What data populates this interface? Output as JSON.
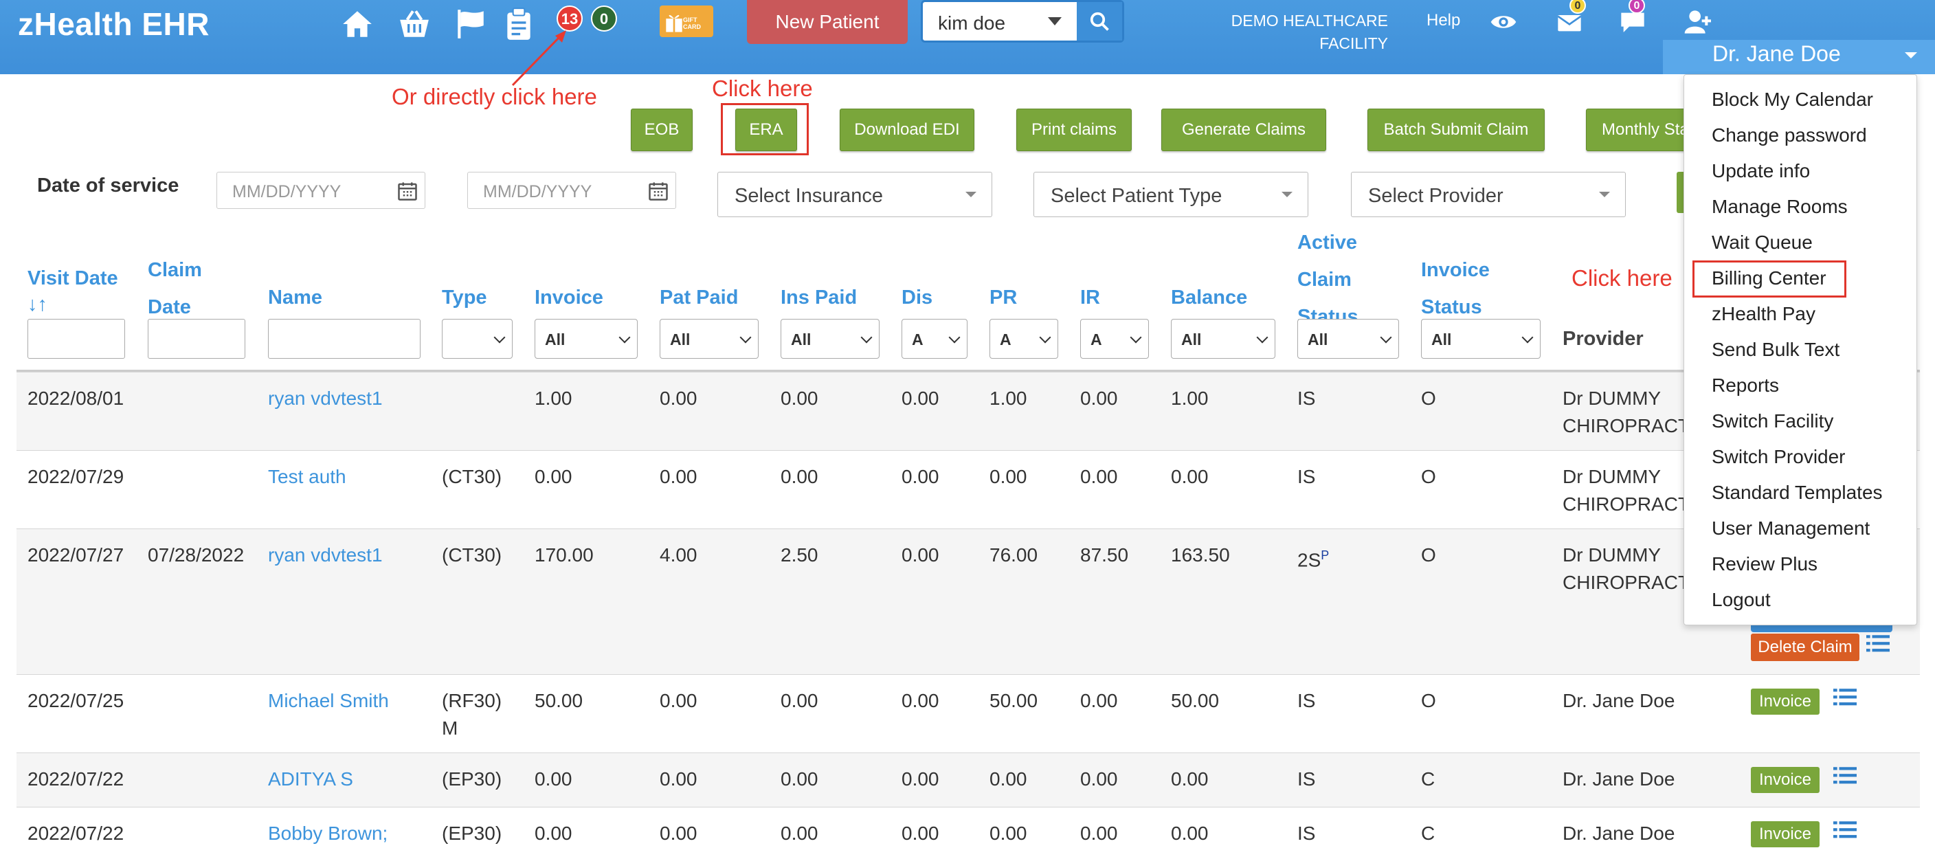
{
  "header": {
    "brand": "zHealth EHR",
    "badge_red": "13",
    "badge_green": "0",
    "gift_label": "GIFT CARD",
    "new_patient": "New Patient",
    "search_value": "kim doe",
    "facility_line1": "DEMO HEALTHCARE",
    "facility_line2": "FACILITY",
    "help": "Help",
    "mail_badge": "0",
    "chat_badge": "0",
    "user": "Dr. Jane Doe",
    "icons": [
      "home-icon",
      "basket-icon",
      "flag-icon",
      "clipboard-icon",
      "eye-icon",
      "mail-icon",
      "chat-icon",
      "add-user-icon",
      "search-icon"
    ]
  },
  "annotations": {
    "direct": "Or directly click here",
    "click_era": "Click here",
    "click_billing": "Click here"
  },
  "buttons": {
    "eob": "EOB",
    "era": "ERA",
    "download_edi": "Download EDI",
    "print_claims": "Print claims",
    "generate_claims": "Generate Claims",
    "batch_submit": "Batch Submit Claim",
    "monthly": "Monthly Sta"
  },
  "filters": {
    "dos_label": "Date of service",
    "from_placeholder": "MM/DD/YYYY",
    "to_placeholder": "MM/DD/YYYY",
    "insurance": "Select Insurance",
    "patient_type": "Select Patient Type",
    "provider": "Select Provider"
  },
  "columns": {
    "visit_date_1": "Visit Date",
    "visit_date_2": "↓↑",
    "claim_date_1": "Claim",
    "claim_date_2": "Date",
    "name": "Name",
    "type": "Type",
    "invoice": "Invoice",
    "pat_paid": "Pat Paid",
    "ins_paid": "Ins Paid",
    "dis": "Dis",
    "pr": "PR",
    "ir": "IR",
    "balance": "Balance",
    "active_1": "Active",
    "active_2": "Claim",
    "active_3": "Status",
    "invoice_status_1": "Invoice",
    "invoice_status_2": "Status",
    "provider": "Provider"
  },
  "column_filters": {
    "all": "All",
    "short": "A"
  },
  "rows": [
    {
      "visit": "2022/08/01",
      "claim": "",
      "name": "ryan vdvtest1",
      "type": "",
      "type2": "",
      "invoice": "1.00",
      "pat": "0.00",
      "ins": "0.00",
      "dis": "0.00",
      "pr": "1.00",
      "ir": "0.00",
      "bal": "1.00",
      "status": "IS",
      "status_sup": "",
      "inv_status": "O",
      "prov1": "Dr DUMMY",
      "prov2": "CHIROPRACT"
    },
    {
      "visit": "2022/07/29",
      "claim": "",
      "name": "Test auth",
      "type": "(CT30)",
      "type2": "",
      "invoice": "0.00",
      "pat": "0.00",
      "ins": "0.00",
      "dis": "0.00",
      "pr": "0.00",
      "ir": "0.00",
      "bal": "0.00",
      "status": "IS",
      "status_sup": "",
      "inv_status": "O",
      "prov1": "Dr DUMMY",
      "prov2": "CHIROPRACT"
    },
    {
      "visit": "2022/07/27",
      "claim": "07/28/2022",
      "name": "ryan vdvtest1",
      "type": "(CT30)",
      "type2": "",
      "invoice": "170.00",
      "pat": "4.00",
      "ins": "2.50",
      "dis": "0.00",
      "pr": "76.00",
      "ir": "87.50",
      "bal": "163.50",
      "status": "2S",
      "status_sup": "P",
      "inv_status": "O",
      "prov1": "Dr DUMMY",
      "prov2": "CHIROPRACT",
      "action": "Delete Claim"
    },
    {
      "visit": "2022/07/25",
      "claim": "",
      "name": "Michael Smith",
      "type": "(RF30)",
      "type2": "M",
      "invoice": "50.00",
      "pat": "0.00",
      "ins": "0.00",
      "dis": "0.00",
      "pr": "50.00",
      "ir": "0.00",
      "bal": "50.00",
      "status": "IS",
      "status_sup": "",
      "inv_status": "O",
      "prov1": "Dr. Jane Doe",
      "prov2": "",
      "action": "Invoice"
    },
    {
      "visit": "2022/07/22",
      "claim": "",
      "name": "ADITYA S",
      "type": "(EP30)",
      "type2": "",
      "invoice": "0.00",
      "pat": "0.00",
      "ins": "0.00",
      "dis": "0.00",
      "pr": "0.00",
      "ir": "0.00",
      "bal": "0.00",
      "status": "IS",
      "status_sup": "",
      "inv_status": "C",
      "prov1": "Dr. Jane Doe",
      "prov2": "",
      "action": "Invoice"
    },
    {
      "visit": "2022/07/22",
      "claim": "",
      "name": "Bobby Brown;",
      "type": "(EP30)",
      "type2": "",
      "invoice": "0.00",
      "pat": "0.00",
      "ins": "0.00",
      "dis": "0.00",
      "pr": "0.00",
      "ir": "0.00",
      "bal": "0.00",
      "status": "IS",
      "status_sup": "",
      "inv_status": "C",
      "prov1": "Dr. Jane Doe",
      "prov2": "",
      "action": "Invoice"
    }
  ],
  "menu": [
    "Block My Calendar",
    "Change password",
    "Update info",
    "Manage Rooms",
    "Wait Queue",
    "Billing Center",
    "zHealth Pay",
    "Send Bulk Text",
    "Reports",
    "Switch Facility",
    "Switch Provider",
    "Standard Templates",
    "User Management",
    "Review Plus",
    "Logout"
  ],
  "colors": {
    "header_blue": "#3f8fd9",
    "link_blue": "#3d94dc",
    "button_green": "#7aa63b",
    "new_patient_red": "#c9585a",
    "delete_orange": "#d95d24",
    "annotation_red": "#e8392f"
  }
}
